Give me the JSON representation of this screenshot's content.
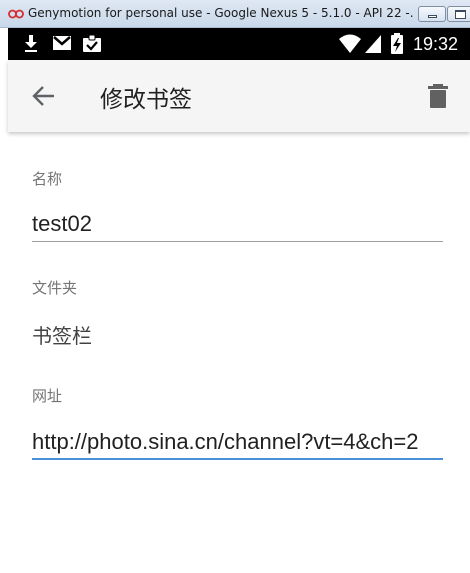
{
  "window": {
    "title": "Genymotion for personal use - Google Nexus 5 - 5.1.0 - API 22 -..."
  },
  "status_bar": {
    "time": "19:32",
    "left_icons": [
      "download-icon",
      "gmail-icon",
      "clipboard-check-icon"
    ],
    "right_icons": [
      "wifi-icon",
      "signal-icon",
      "battery-charging-icon"
    ]
  },
  "app_bar": {
    "title": "修改书签",
    "back_icon": "arrow-back-icon",
    "delete_icon": "trash-icon"
  },
  "form": {
    "name_label": "名称",
    "name_value": "test02",
    "folder_label": "文件夹",
    "folder_value": "书签栏",
    "url_label": "网址",
    "url_value": "http://photo.sina.cn/channel?vt=4&ch=2"
  },
  "colors": {
    "app_bar_bg": "#f5f5f5",
    "focus_underline": "#4a90d9",
    "status_bar_bg": "#000000"
  }
}
